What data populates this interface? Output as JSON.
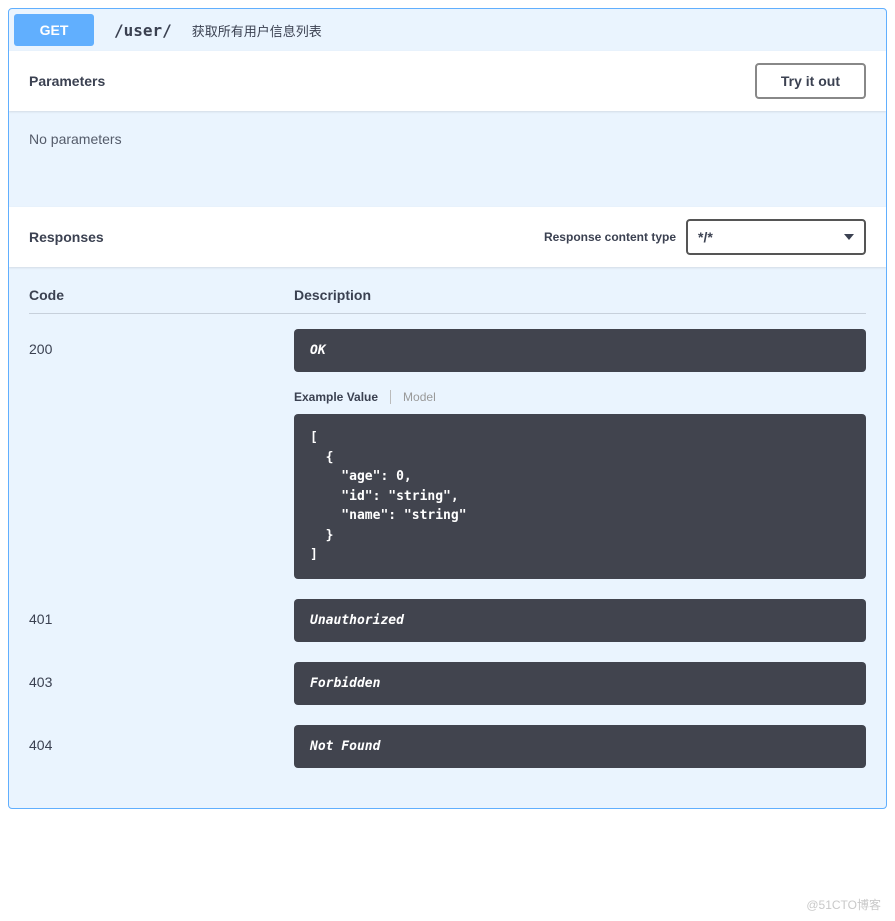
{
  "summary": {
    "method": "GET",
    "path": "/user/",
    "description": "获取所有用户信息列表"
  },
  "parameters": {
    "title": "Parameters",
    "try_label": "Try it out",
    "no_params": "No parameters"
  },
  "responses": {
    "title": "Responses",
    "content_type_label": "Response content type",
    "content_type_value": "*/*",
    "head_code": "Code",
    "head_desc": "Description",
    "tabs": {
      "example": "Example Value",
      "model": "Model"
    },
    "rows": [
      {
        "code": "200",
        "desc": "OK",
        "example": "[\n  {\n    \"age\": 0,\n    \"id\": \"string\",\n    \"name\": \"string\"\n  }\n]"
      },
      {
        "code": "401",
        "desc": "Unauthorized"
      },
      {
        "code": "403",
        "desc": "Forbidden"
      },
      {
        "code": "404",
        "desc": "Not Found"
      }
    ]
  },
  "watermark": "@51CTO博客"
}
